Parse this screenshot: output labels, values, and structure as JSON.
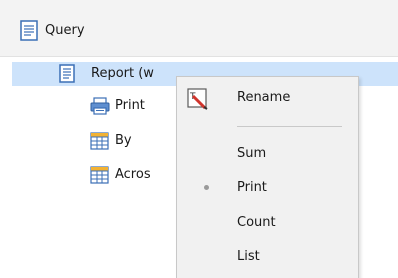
{
  "query": {
    "label": "Query"
  },
  "tree": {
    "report_label": "Report (w",
    "children": [
      {
        "label": "Print",
        "icon": "print-icon"
      },
      {
        "label": "By",
        "icon": "grid-icon"
      },
      {
        "label": "Acros",
        "icon": "grid-icon"
      }
    ]
  },
  "context_menu": {
    "items": [
      {
        "label": "Rename",
        "icon": "rename-icon"
      },
      {
        "label": "Sum"
      },
      {
        "label": "Print",
        "selected": true
      },
      {
        "label": "Count"
      },
      {
        "label": "List"
      }
    ]
  }
}
